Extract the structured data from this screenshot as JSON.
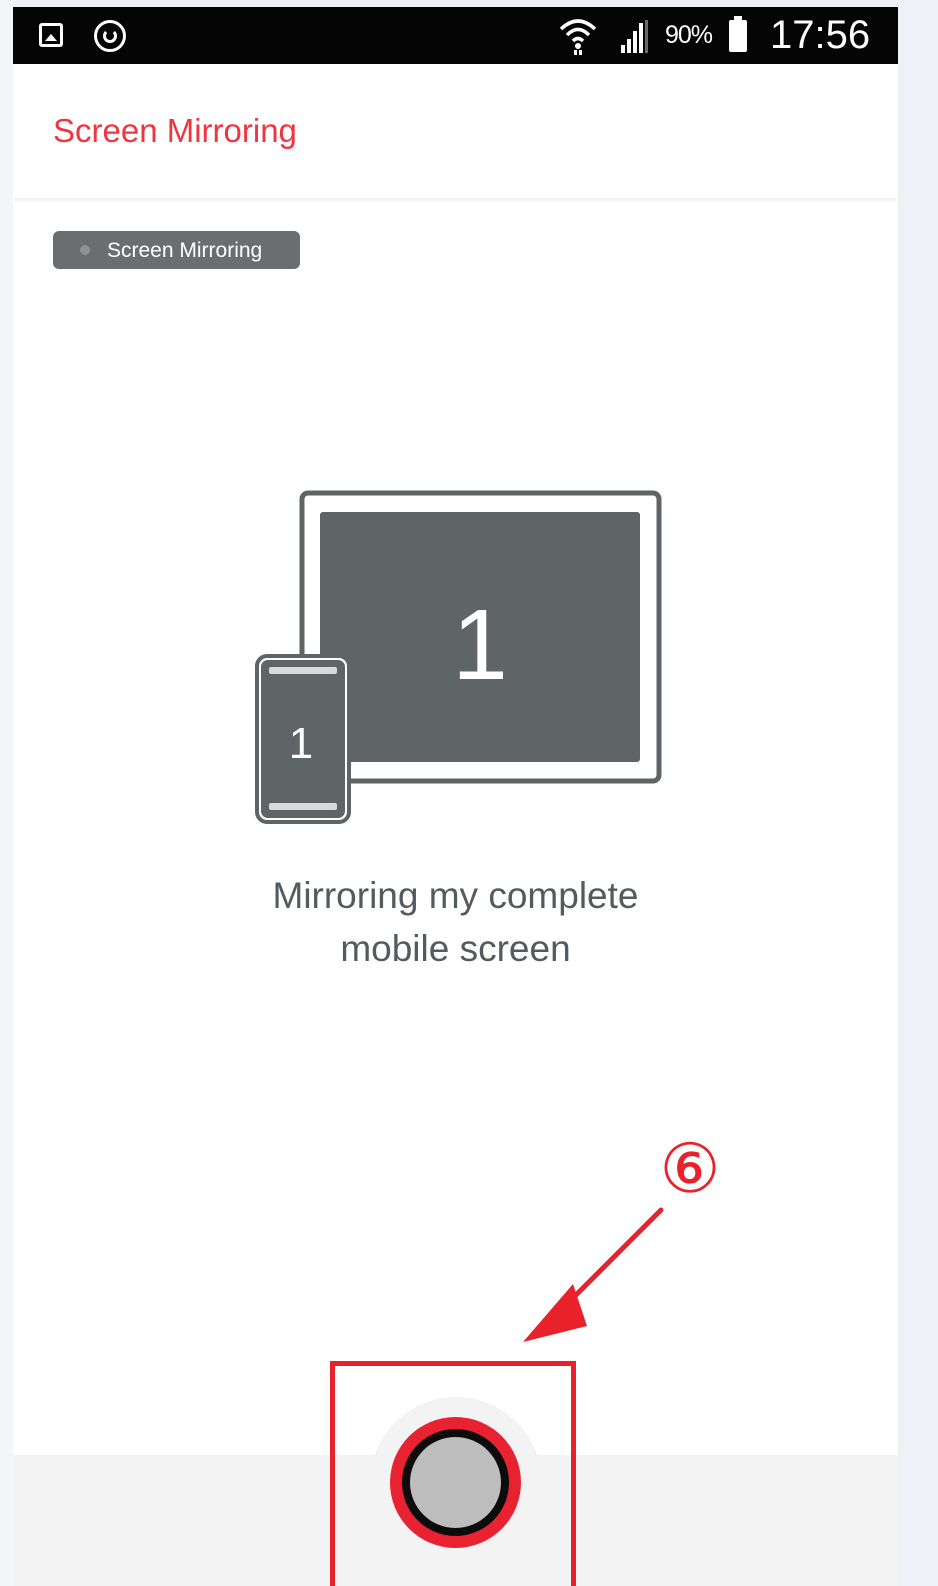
{
  "status_bar": {
    "icons": [
      "gallery-icon",
      "sync-icon",
      "wifi-icon",
      "signal-icon",
      "battery-icon"
    ],
    "battery_percent": "90%",
    "time": "17:56"
  },
  "header": {
    "title": "Screen Mirroring",
    "title_color": "#f1353f"
  },
  "mode_tag": {
    "label": "Screen Mirroring"
  },
  "illustration": {
    "monitor_number": "1",
    "phone_number": "1"
  },
  "caption": {
    "line1": "Mirroring my complete",
    "line2": "mobile screen"
  },
  "annotation": {
    "step_number": "⑥",
    "highlight_color": "#e8212a"
  },
  "record_button": {
    "icon": "record-icon",
    "accent_color": "#e92232"
  }
}
